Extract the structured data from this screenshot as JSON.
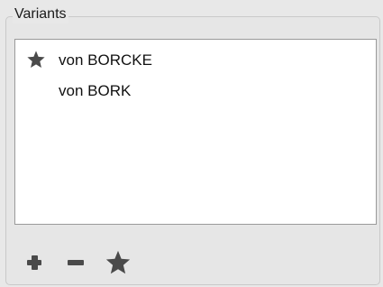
{
  "group": {
    "title": "Variants"
  },
  "variants": [
    {
      "label": "von BORCKE",
      "preferred": true
    },
    {
      "label": "von BORK",
      "preferred": false
    }
  ],
  "toolbar": {
    "add_icon": "plus-icon",
    "remove_icon": "minus-icon",
    "preferred_icon": "star-icon"
  },
  "colors": {
    "icon": "#4a4a4a",
    "list_border": "#9a9a9a",
    "background": "#e8e8e8"
  }
}
